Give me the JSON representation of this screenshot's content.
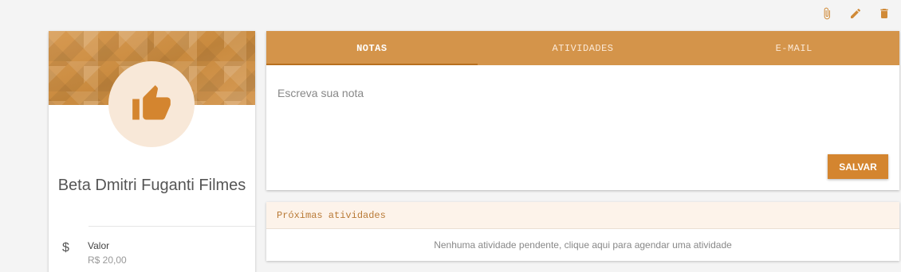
{
  "toolbar": {
    "icons": [
      "paperclip-icon",
      "pencil-icon",
      "trash-icon"
    ],
    "accent_color": "#d08a38"
  },
  "profile": {
    "name": "Beta Dmitri Fuganti Filmes",
    "avatar_icon": "thumbs-up-icon",
    "value_label": "Valor",
    "value": "R$ 20,00",
    "value_icon_symbol": "$"
  },
  "notes": {
    "tabs": [
      {
        "label": "NOTAS",
        "active": true
      },
      {
        "label": "ATIVIDADES",
        "active": false
      },
      {
        "label": "E-MAIL",
        "active": false
      }
    ],
    "input_placeholder": "Escreva sua nota",
    "input_value": "",
    "save_label": "SALVAR"
  },
  "activities": {
    "title": "Próximas atividades",
    "empty_message": "Nenhuma atividade pendente, clique aqui para agendar uma atividade"
  }
}
